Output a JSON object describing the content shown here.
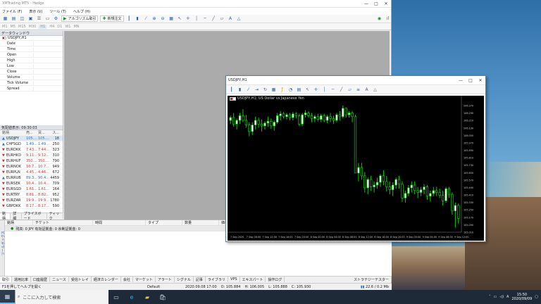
{
  "main_window": {
    "title": "XMTrading MT5 - Hedge",
    "menu": [
      "ファイル (F)",
      "表示 (V)",
      "ツール (T)",
      "ヘルプ (H)"
    ],
    "toolbar": {
      "algo_label": "アルゴリズム取引",
      "new_order_label": "新規注文"
    },
    "timeframes": [
      "M1",
      "M5",
      "M15",
      "M30",
      "H1",
      "H4",
      "D1",
      "W1",
      "MN"
    ],
    "window_controls": [
      "—",
      "□",
      "✕"
    ]
  },
  "data_window": {
    "title": "データウィンドウ",
    "symbol": "USDJPY,H1",
    "rows": [
      "Date",
      "Time",
      "Open",
      "High",
      "Low",
      "Close",
      "Volume",
      "Tick Volume",
      "Spread"
    ]
  },
  "market_watch": {
    "title": "気配値表示: 09:30:03",
    "columns": [
      "銘柄",
      "売...",
      "買...",
      "ス..."
    ],
    "rows": [
      {
        "symbol": "USDJPY",
        "bid": "105....",
        "ask": "105....",
        "spread": "18",
        "dir": "up",
        "selected": true
      },
      {
        "symbol": "CHFSGD",
        "bid": "1.49...",
        "ask": "1.49...",
        "spread": "250",
        "dir": "up"
      },
      {
        "symbol": "EURDKK",
        "bid": "7.43...",
        "ask": "7.44...",
        "spread": "323",
        "dir": "down"
      },
      {
        "symbol": "EURHKD",
        "bid": "9.11...",
        "ask": "9.12...",
        "spread": "310",
        "dir": "down"
      },
      {
        "symbol": "EURHUF",
        "bid": "350....",
        "ask": "350....",
        "spread": "790",
        "dir": "down"
      },
      {
        "symbol": "EURNOK",
        "bid": "10.7...",
        "ask": "10.7...",
        "spread": "949",
        "dir": "down"
      },
      {
        "symbol": "EURPLN",
        "bid": "4.45...",
        "ask": "4.46...",
        "spread": "672",
        "dir": "down"
      },
      {
        "symbol": "EURRUB",
        "bid": "89.3...",
        "ask": "90.4...",
        "spread": "4459",
        "dir": "up"
      },
      {
        "symbol": "EURSEK",
        "bid": "10.4...",
        "ask": "10.4...",
        "spread": "709",
        "dir": "down"
      },
      {
        "symbol": "EURSGD",
        "bid": "1.61...",
        "ask": "1.61...",
        "spread": "164",
        "dir": "down"
      },
      {
        "symbol": "EURTRY",
        "bid": "8.81...",
        "ask": "8.82...",
        "spread": "952",
        "dir": "down"
      },
      {
        "symbol": "EURZAR",
        "bid": "19.9...",
        "ask": "19.9...",
        "spread": "1780",
        "dir": "down"
      },
      {
        "symbol": "GBPDKK",
        "bid": "8.17...",
        "ask": "8.17...",
        "spread": "590",
        "dir": "down"
      }
    ],
    "tabs": [
      "銘柄",
      "詳細",
      "プライスボード",
      "ティック"
    ]
  },
  "toolbox": {
    "columns": [
      "銘柄",
      "チケット",
      "時間",
      "タイプ",
      "数量",
      "価格"
    ],
    "balance_text": "残高: 0 JPY  有効証拠金: 0  余剰証拠金: 0",
    "side_label": "ツールボックス",
    "tabs": [
      "取引",
      "運用比率",
      "口座履歴",
      "ニュース",
      "受信トレイ",
      "経済カレンダー",
      "会社",
      "マーケット",
      "アラート",
      "シグナル",
      "記事",
      "ライブラリ",
      "VPS",
      "エキスパート",
      "操作ログ"
    ],
    "tester_tab": "ストラテジーテスター"
  },
  "status_bar": {
    "help": "F1を押してヘルプを開く",
    "profile": "Default",
    "datetime": "2020.09.08 17:00",
    "open": "O: 105.884",
    "high": "H: 106.005",
    "low": "L: 105.888",
    "close": "C: 105.930",
    "traffic": "22.6 / 0.2 Mb"
  },
  "chart_window": {
    "title": "USDJPY,H1",
    "legend": "USDJPY,H1: US Dollar vs Japanese Yen",
    "window_controls": [
      "—",
      "□",
      "✕"
    ]
  },
  "chart_data": {
    "type": "candlestick",
    "title": "USDJPY,H1: US Dollar vs Japanese Yen",
    "ylim": [
      105.01,
      106.38
    ],
    "yticks": [
      "106.370",
      "106.330",
      "106.290",
      "106.250",
      "106.210",
      "106.170",
      "106.130",
      "106.090",
      "106.050",
      "106.010",
      "105.970",
      "105.930",
      "105.890",
      "105.850",
      "105.810",
      "105.770",
      "105.730",
      "105.690",
      "105.650",
      "105.610",
      "105.570",
      "105.530",
      "105.490",
      "105.450",
      "105.410",
      "105.370",
      "105.330",
      "105.290",
      "105.250",
      "105.210",
      "105.170",
      "105.130",
      "105.090",
      "105.050",
      "105.010"
    ],
    "xticks": [
      "7 Sep 2020",
      "7 Sep 08:00",
      "7 Sep 12:00",
      "7 Sep 16:00",
      "7 Sep 20:00",
      "8 Sep 00:00",
      "8 Sep 04:00",
      "8 Sep 08:00",
      "8 Sep 12:00",
      "8 Sep 16:00",
      "8 Sep 20:00",
      "9 Sep 00:00",
      "9 Sep 04:00",
      "9 Sep 08:00",
      "9 Sep 12:00"
    ],
    "candles": [
      [
        106.22,
        106.27,
        106.18,
        106.25
      ],
      [
        106.25,
        106.3,
        106.15,
        106.18
      ],
      [
        106.18,
        106.24,
        106.12,
        106.22
      ],
      [
        106.22,
        106.3,
        106.18,
        106.27
      ],
      [
        106.27,
        106.34,
        106.2,
        106.22
      ],
      [
        106.22,
        106.28,
        106.14,
        106.17
      ],
      [
        106.17,
        106.2,
        106.05,
        106.1
      ],
      [
        106.1,
        106.2,
        106.06,
        106.17
      ],
      [
        106.17,
        106.26,
        106.12,
        106.22
      ],
      [
        106.22,
        106.25,
        106.14,
        106.18
      ],
      [
        106.18,
        106.23,
        106.1,
        106.16
      ],
      [
        106.16,
        106.21,
        106.12,
        106.19
      ],
      [
        106.19,
        106.26,
        106.15,
        106.21
      ],
      [
        106.21,
        106.24,
        106.13,
        106.16
      ],
      [
        106.16,
        106.22,
        106.11,
        106.2
      ],
      [
        106.2,
        106.3,
        106.18,
        106.27
      ],
      [
        106.27,
        106.32,
        106.22,
        106.29
      ],
      [
        106.29,
        106.31,
        106.24,
        106.26
      ],
      [
        106.26,
        106.3,
        106.23,
        106.28
      ],
      [
        106.28,
        106.3,
        106.22,
        106.25
      ],
      [
        106.25,
        106.31,
        106.22,
        106.29
      ],
      [
        106.29,
        106.31,
        106.24,
        106.27
      ],
      [
        106.27,
        106.29,
        106.16,
        106.18
      ],
      [
        106.18,
        106.3,
        106.16,
        106.28
      ],
      [
        106.28,
        106.33,
        106.25,
        106.3
      ],
      [
        106.3,
        106.32,
        106.25,
        106.27
      ],
      [
        106.27,
        106.3,
        106.2,
        106.24
      ],
      [
        106.24,
        106.28,
        106.2,
        106.26
      ],
      [
        106.26,
        106.29,
        106.21,
        106.23
      ],
      [
        106.23,
        106.29,
        106.2,
        106.27
      ],
      [
        106.27,
        106.29,
        106.2,
        106.22
      ],
      [
        106.22,
        106.28,
        106.19,
        106.26
      ],
      [
        106.26,
        106.3,
        106.2,
        106.24
      ],
      [
        106.24,
        106.27,
        106.18,
        106.22
      ],
      [
        106.22,
        106.3,
        106.2,
        106.28
      ],
      [
        106.28,
        106.32,
        106.22,
        106.26
      ],
      [
        106.26,
        106.38,
        106.24,
        106.35
      ],
      [
        106.35,
        106.36,
        106.25,
        106.28
      ],
      [
        106.28,
        106.32,
        106.25,
        106.3
      ],
      [
        106.3,
        106.32,
        106.2,
        106.26
      ],
      [
        106.26,
        106.28,
        106.0,
        105.65
      ],
      [
        105.65,
        105.76,
        105.56,
        105.71
      ],
      [
        105.71,
        105.76,
        105.58,
        105.62
      ],
      [
        105.62,
        105.66,
        105.44,
        105.49
      ],
      [
        105.49,
        105.6,
        105.42,
        105.58
      ],
      [
        105.58,
        105.62,
        105.46,
        105.5
      ],
      [
        105.5,
        105.56,
        105.44,
        105.52
      ],
      [
        105.52,
        105.6,
        105.48,
        105.55
      ],
      [
        105.55,
        105.64,
        105.5,
        105.62
      ],
      [
        105.62,
        105.68,
        105.52,
        105.56
      ],
      [
        105.56,
        105.62,
        105.45,
        105.5
      ],
      [
        105.5,
        105.56,
        105.42,
        105.47
      ],
      [
        105.47,
        105.55,
        105.4,
        105.52
      ],
      [
        105.52,
        105.6,
        105.48,
        105.58
      ],
      [
        105.58,
        105.62,
        105.48,
        105.53
      ],
      [
        105.53,
        105.56,
        105.34,
        105.38
      ],
      [
        105.38,
        105.46,
        105.33,
        105.43
      ],
      [
        105.43,
        105.52,
        105.4,
        105.49
      ],
      [
        105.49,
        105.56,
        105.44,
        105.52
      ],
      [
        105.52,
        105.56,
        105.42,
        105.46
      ],
      [
        105.46,
        105.5,
        105.38,
        105.44
      ],
      [
        105.44,
        105.5,
        105.4,
        105.47
      ],
      [
        105.47,
        105.53,
        105.42,
        105.5
      ],
      [
        105.5,
        105.52,
        105.36,
        105.4
      ],
      [
        105.4,
        105.46,
        105.34,
        105.43
      ],
      [
        105.43,
        105.5,
        105.4,
        105.46
      ],
      [
        105.46,
        105.5,
        105.4,
        105.44
      ],
      [
        105.44,
        105.48,
        105.38,
        105.41
      ],
      [
        105.41,
        105.46,
        105.3,
        105.35
      ],
      [
        105.35,
        105.5,
        105.33,
        105.48
      ],
      [
        105.48,
        105.5,
        105.38,
        105.42
      ],
      [
        105.42,
        105.44,
        105.2,
        105.24
      ],
      [
        105.24,
        105.33,
        105.06,
        105.3
      ],
      [
        105.3,
        105.32,
        105.1,
        105.16
      ]
    ],
    "grid": false,
    "up_color": "#ffffff",
    "down_color": "#000000",
    "wick_color": "#00d200",
    "background": "#000000"
  },
  "taskbar": {
    "search_placeholder": "ここに入力して検索",
    "time": "15:50",
    "date": "2020/09/09"
  }
}
